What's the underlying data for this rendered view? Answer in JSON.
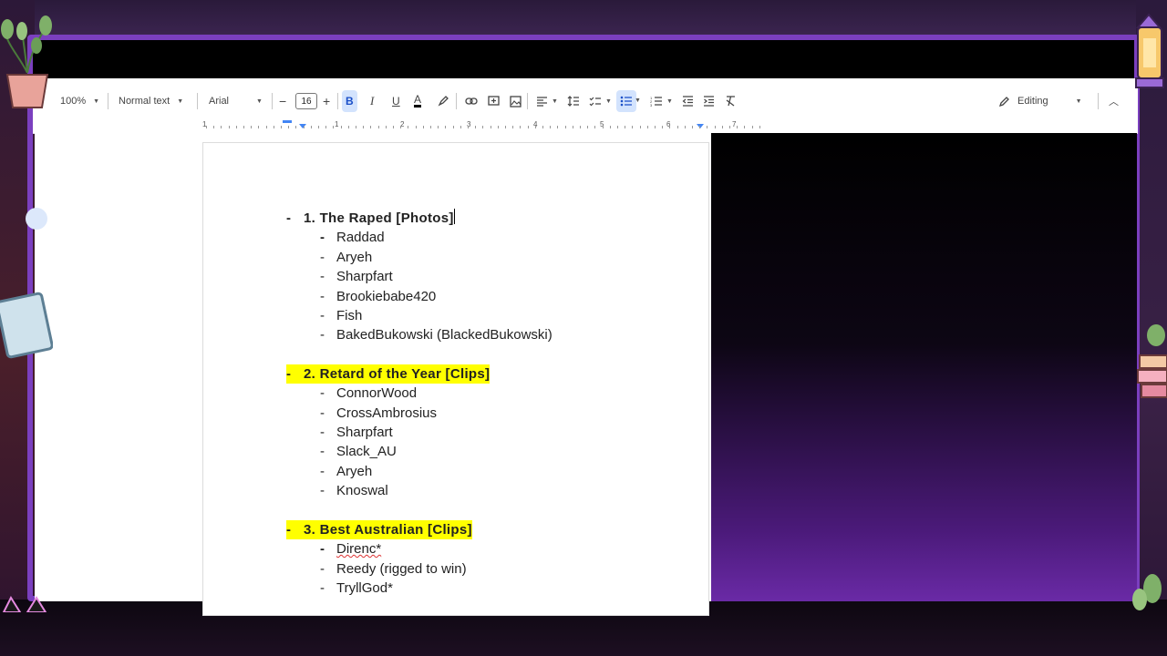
{
  "toolbar": {
    "zoom": "100%",
    "style": "Normal text",
    "font": "Arial",
    "font_size": "16",
    "mode": "Editing"
  },
  "ruler": {
    "numbers": [
      "1",
      "1",
      "2",
      "3",
      "4",
      "5",
      "6",
      "7"
    ]
  },
  "document": {
    "sections": [
      {
        "heading": "1. The Raped [Photos]",
        "highlighted": false,
        "items": [
          "Raddad",
          "Aryeh",
          "Sharpfart",
          "Brookiebabe420",
          "Fish",
          "BakedBukowski (BlackedBukowski)"
        ]
      },
      {
        "heading": "2. Retard of the Year [Clips]",
        "highlighted": true,
        "items": [
          "ConnorWood",
          "CrossAmbrosius",
          "Sharpfart",
          "Slack_AU",
          "Aryeh",
          "Knoswal"
        ]
      },
      {
        "heading": "3. Best Australian [Clips]",
        "highlighted": true,
        "items": [
          "Direnc*",
          "Reedy (rigged to win)",
          "TryllGod*"
        ]
      }
    ],
    "bullet": "-"
  },
  "colors": {
    "highlight": "#ffff00",
    "frame": "#7b3fbf",
    "active_button": "#d3e3fd"
  },
  "icons": [
    "minus-icon",
    "plus-icon",
    "bold-icon",
    "italic-icon",
    "underline-icon",
    "text-color-icon",
    "highlight-icon",
    "link-icon",
    "comment-icon",
    "image-icon",
    "align-icon",
    "line-spacing-icon",
    "checklist-icon",
    "bullet-list-icon",
    "numbered-list-icon",
    "decrease-indent-icon",
    "increase-indent-icon",
    "clear-formatting-icon",
    "pencil-icon",
    "collapse-icon"
  ]
}
